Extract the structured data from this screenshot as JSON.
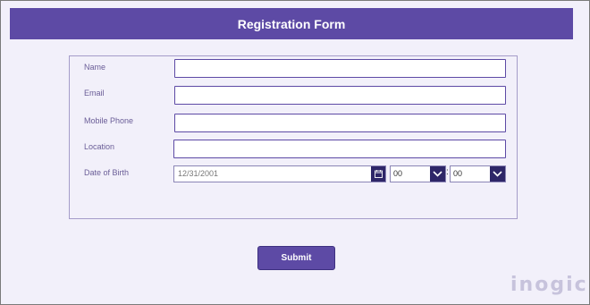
{
  "header": {
    "title": "Registration Form"
  },
  "fields": {
    "name_label": "Name",
    "email_label": "Email",
    "mobile_label": "Mobile Phone",
    "location_label": "Location",
    "dob_label": "Date of Birth"
  },
  "dob": {
    "date_value": "12/31/2001",
    "hour_value": "00",
    "minute_value": "00",
    "separator": ":"
  },
  "submit_label": "Submit",
  "logo_text": "inogic",
  "colors": {
    "accent": "#5d4aa5",
    "dark_button": "#2e2668",
    "background": "#f2f0fa"
  }
}
